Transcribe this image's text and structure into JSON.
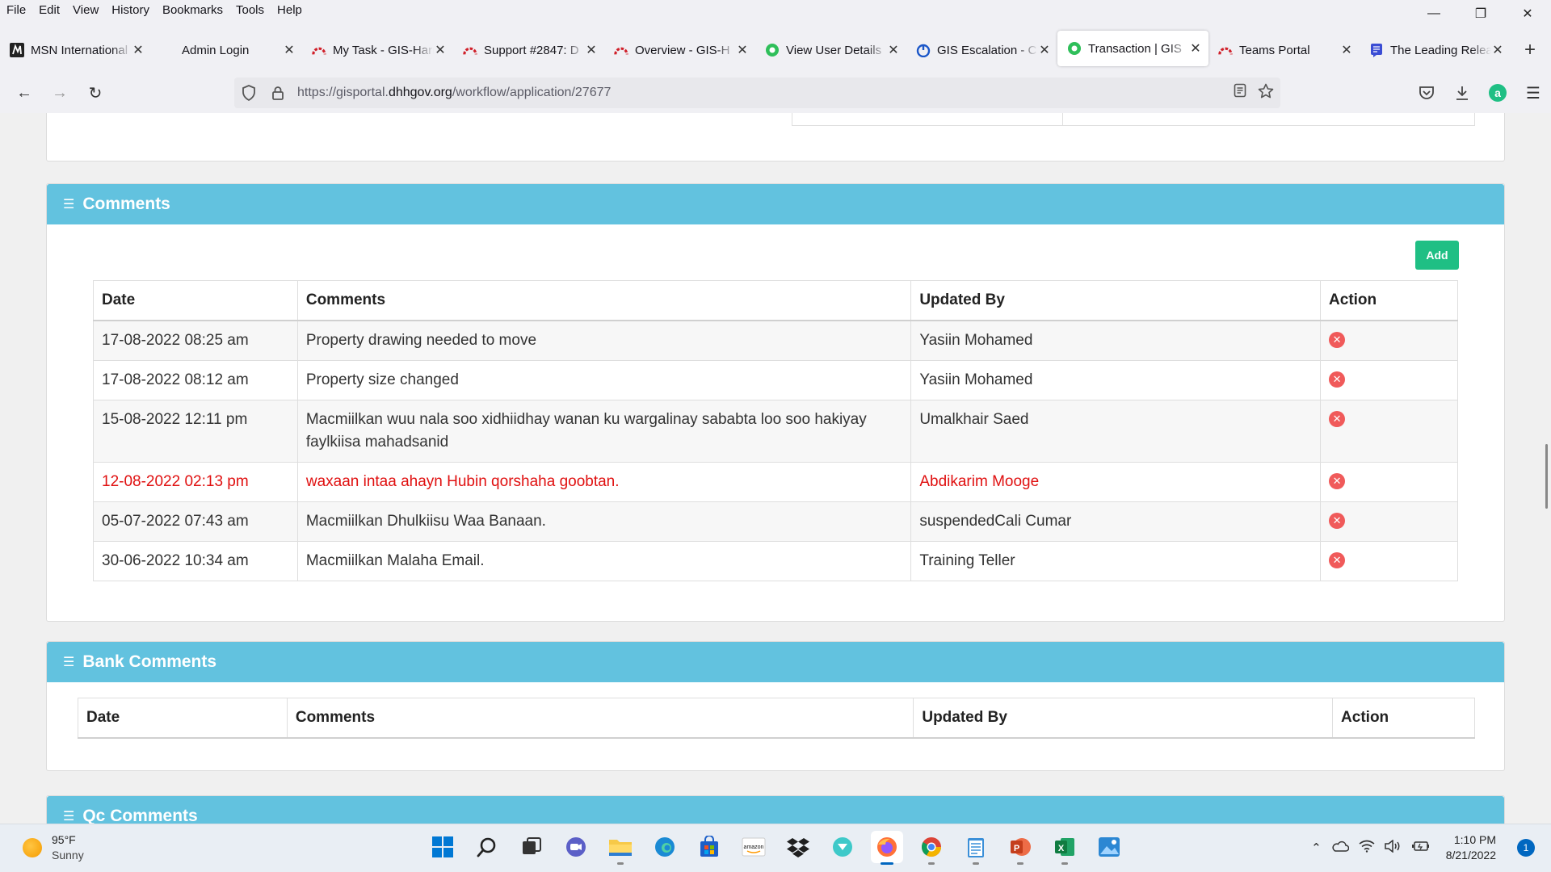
{
  "menu": [
    "File",
    "Edit",
    "View",
    "History",
    "Bookmarks",
    "Tools",
    "Help"
  ],
  "tabs": [
    {
      "label": "MSN International",
      "icon": "msn-icon",
      "color": "#222222",
      "active": false
    },
    {
      "label": "Admin Login",
      "icon": "none",
      "color": "#ffffff",
      "active": false
    },
    {
      "label": "My Task - GIS-Harmony",
      "icon": "arc-icon",
      "color": "#d0202a",
      "active": false
    },
    {
      "label": "Support #2847: D",
      "icon": "arc-icon",
      "color": "#d0202a",
      "active": false
    },
    {
      "label": "Overview - GIS-H",
      "icon": "arc-icon",
      "color": "#d0202a",
      "active": false
    },
    {
      "label": "View User Details",
      "icon": "gis-logo-icon",
      "color": "#2fbf5a",
      "active": false
    },
    {
      "label": "GIS Escalation - C",
      "icon": "power-icon",
      "color": "#1a56c8",
      "active": false
    },
    {
      "label": "Transaction | GIS",
      "icon": "gis-logo-icon",
      "color": "#2fbf5a",
      "active": true
    },
    {
      "label": "Teams Portal",
      "icon": "arc-icon",
      "color": "#d0202a",
      "active": false
    },
    {
      "label": "The Leading Relea",
      "icon": "doc-icon",
      "color": "#3b4dd4",
      "active": false
    }
  ],
  "url": {
    "prefix": "https://gisportal.",
    "domain": "dhhgov.org",
    "path": "/workflow/application/27677"
  },
  "comments": {
    "title": "Comments",
    "add_label": "Add",
    "headers": [
      "Date",
      "Comments",
      "Updated By",
      "Action"
    ],
    "rows": [
      {
        "date": "17-08-2022 08:25 am",
        "comment": "Property drawing needed to move",
        "by": "Yasiin Mohamed",
        "highlight": false
      },
      {
        "date": "17-08-2022 08:12 am",
        "comment": "Property size changed",
        "by": "Yasiin Mohamed",
        "highlight": false
      },
      {
        "date": "15-08-2022 12:11 pm",
        "comment": "Macmiilkan wuu nala soo xidhiidhay wanan ku wargalinay sababta loo soo hakiyay faylkiisa mahadsanid",
        "by": "Umalkhair Saed",
        "highlight": false
      },
      {
        "date": "12-08-2022 02:13 pm",
        "comment": "waxaan intaa ahayn Hubin qorshaha goobtan.",
        "by": "Abdikarim Mooge",
        "highlight": true
      },
      {
        "date": "05-07-2022 07:43 am",
        "comment": "Macmiilkan Dhulkiisu Waa Banaan.",
        "by": "suspendedCali Cumar",
        "highlight": false
      },
      {
        "date": "30-06-2022 10:34 am",
        "comment": "Macmiilkan Malaha Email.",
        "by": "Training Teller",
        "highlight": false
      }
    ]
  },
  "bank_comments": {
    "title": "Bank Comments",
    "headers": [
      "Date",
      "Comments",
      "Updated By",
      "Action"
    ]
  },
  "qc_comments": {
    "title": "Qc Comments"
  },
  "weather": {
    "temp": "95°F",
    "condition": "Sunny"
  },
  "clock": {
    "time": "1:10 PM",
    "date": "8/21/2022"
  },
  "notifications": "1",
  "colors": {
    "panel_header": "#62c2df",
    "add_button": "#1fbf84",
    "delete_icon": "#f05a5a",
    "highlight_text": "#e01010"
  }
}
